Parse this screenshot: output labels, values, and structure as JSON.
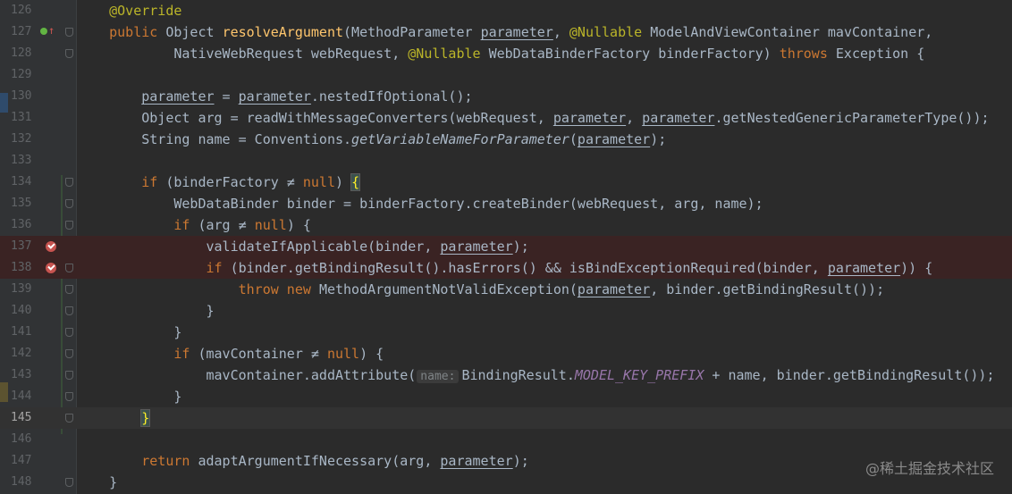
{
  "editor": {
    "lines": [
      {
        "n": "126",
        "tokens": [
          [
            "    ",
            ""
          ],
          [
            "@Override",
            "ann"
          ]
        ]
      },
      {
        "n": "127",
        "tokens": [
          [
            "    ",
            ""
          ],
          [
            "public ",
            "kw"
          ],
          [
            "Object ",
            ""
          ],
          [
            "resolveArgument",
            "fn"
          ],
          [
            "(MethodParameter ",
            ""
          ],
          [
            "parameter",
            "param"
          ],
          [
            ", ",
            ""
          ],
          [
            "@Nullable ",
            "ann"
          ],
          [
            "ModelAndViewContainer mavContainer,",
            ""
          ]
        ]
      },
      {
        "n": "128",
        "tokens": [
          [
            "            NativeWebRequest webRequest, ",
            ""
          ],
          [
            "@Nullable ",
            "ann"
          ],
          [
            "WebDataBinderFactory binderFactory) ",
            ""
          ],
          [
            "throws ",
            "kw"
          ],
          [
            "Exception {",
            ""
          ]
        ]
      },
      {
        "n": "129",
        "tokens": []
      },
      {
        "n": "130",
        "tokens": [
          [
            "        ",
            ""
          ],
          [
            "parameter",
            "param"
          ],
          [
            " = ",
            ""
          ],
          [
            "parameter",
            "param"
          ],
          [
            ".nestedIfOptional();",
            ""
          ]
        ]
      },
      {
        "n": "131",
        "tokens": [
          [
            "        Object arg = readWithMessageConverters(webRequest, ",
            ""
          ],
          [
            "parameter",
            "param"
          ],
          [
            ", ",
            ""
          ],
          [
            "parameter",
            "param"
          ],
          [
            ".getNestedGenericParameterType());",
            ""
          ]
        ]
      },
      {
        "n": "132",
        "tokens": [
          [
            "        String name = Conventions.",
            ""
          ],
          [
            "getVariableNameForParameter",
            "itfn"
          ],
          [
            "(",
            ""
          ],
          [
            "parameter",
            "param"
          ],
          [
            ");",
            ""
          ]
        ]
      },
      {
        "n": "133",
        "tokens": []
      },
      {
        "n": "134",
        "tokens": [
          [
            "        ",
            ""
          ],
          [
            "if ",
            "kw"
          ],
          [
            "(binderFactory ≠ ",
            ""
          ],
          [
            "null",
            "kw"
          ],
          [
            ") ",
            ""
          ],
          [
            "{",
            "brace-hl"
          ]
        ]
      },
      {
        "n": "135",
        "tokens": [
          [
            "            WebDataBinder binder = binderFactory.createBinder(webRequest, arg, name);",
            ""
          ]
        ]
      },
      {
        "n": "136",
        "tokens": [
          [
            "            ",
            ""
          ],
          [
            "if ",
            "kw"
          ],
          [
            "(arg ≠ ",
            ""
          ],
          [
            "null",
            "kw"
          ],
          [
            ") {",
            ""
          ]
        ]
      },
      {
        "n": "137",
        "tokens": [
          [
            "                validateIfApplicable(binder, ",
            ""
          ],
          [
            "parameter",
            "param"
          ],
          [
            ");",
            ""
          ]
        ]
      },
      {
        "n": "138",
        "tokens": [
          [
            "                ",
            ""
          ],
          [
            "if ",
            "kw"
          ],
          [
            "(binder.getBindingResult().hasErrors() && isBindExceptionRequired(binder, ",
            ""
          ],
          [
            "parameter",
            "param"
          ],
          [
            ")) {",
            ""
          ]
        ]
      },
      {
        "n": "139",
        "tokens": [
          [
            "                    ",
            ""
          ],
          [
            "throw new ",
            "kw"
          ],
          [
            "MethodArgumentNotValidException(",
            ""
          ],
          [
            "parameter",
            "param"
          ],
          [
            ", binder.getBindingResult());",
            ""
          ]
        ]
      },
      {
        "n": "140",
        "tokens": [
          [
            "                }",
            ""
          ]
        ]
      },
      {
        "n": "141",
        "tokens": [
          [
            "            }",
            ""
          ]
        ]
      },
      {
        "n": "142",
        "tokens": [
          [
            "            ",
            ""
          ],
          [
            "if ",
            "kw"
          ],
          [
            "(mavContainer ≠ ",
            ""
          ],
          [
            "null",
            "kw"
          ],
          [
            ") {",
            ""
          ]
        ]
      },
      {
        "n": "143",
        "tokens": [
          [
            "                mavContainer.addAttribute(",
            ""
          ],
          [
            "name:",
            "hint"
          ],
          [
            "BindingResult.",
            ""
          ],
          [
            "MODEL_KEY_PREFIX",
            "static"
          ],
          [
            " + name, binder.getBindingResult());",
            ""
          ]
        ]
      },
      {
        "n": "144",
        "tokens": [
          [
            "            }",
            ""
          ]
        ]
      },
      {
        "n": "145",
        "tokens": [
          [
            "        ",
            ""
          ],
          [
            "}",
            "brace-hl"
          ]
        ]
      },
      {
        "n": "146",
        "tokens": []
      },
      {
        "n": "147",
        "tokens": [
          [
            "        ",
            ""
          ],
          [
            "return ",
            "kw"
          ],
          [
            "adaptArgumentIfNecessary(arg, ",
            ""
          ],
          [
            "parameter",
            "param"
          ],
          [
            ");",
            ""
          ]
        ]
      },
      {
        "n": "148",
        "tokens": [
          [
            "    }",
            ""
          ]
        ]
      }
    ],
    "breakpoint_lines": [
      "137",
      "138"
    ],
    "current_line": "145",
    "fold_lines": [
      "127",
      "128",
      "134",
      "135",
      "136",
      "138",
      "139",
      "140",
      "141",
      "142",
      "143",
      "144",
      "145",
      "148"
    ]
  },
  "watermark": "@稀土掘金技术社区",
  "colors": {
    "background": "#2b2b2b",
    "gutter": "#313335",
    "keyword": "#cc7832",
    "annotation": "#bbb529",
    "method": "#ffc66d",
    "static_field": "#9876aa",
    "breakpoint": "#c75450"
  },
  "icons": {
    "override": "override-gutter-icon",
    "breakpoint": "breakpoint-check-icon",
    "fold": "fold-marker-icon"
  }
}
